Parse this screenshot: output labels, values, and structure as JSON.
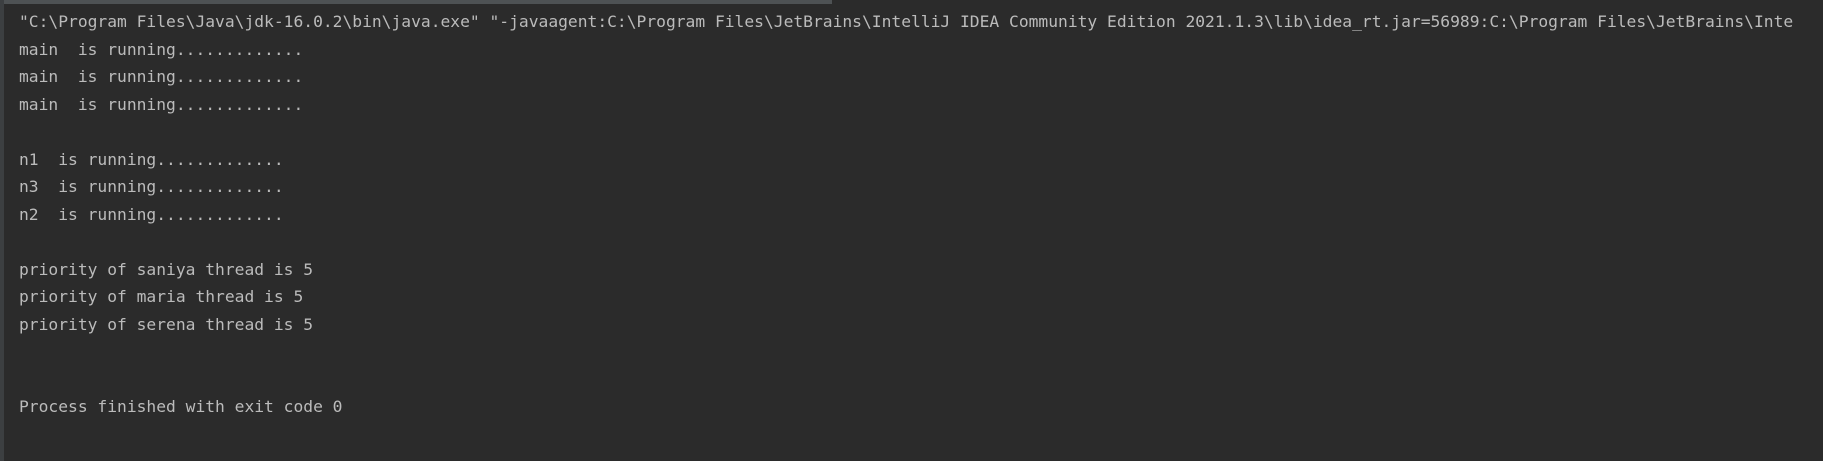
{
  "console": {
    "lines": [
      "\"C:\\Program Files\\Java\\jdk-16.0.2\\bin\\java.exe\" \"-javaagent:C:\\Program Files\\JetBrains\\IntelliJ IDEA Community Edition 2021.1.3\\lib\\idea_rt.jar=56989:C:\\Program Files\\JetBrains\\Inte",
      "main  is running.............",
      "main  is running.............",
      "main  is running.............",
      "",
      "n1  is running.............",
      "n3  is running.............",
      "n2  is running.............",
      "",
      "priority of saniya thread is 5",
      "priority of maria thread is 5",
      "priority of serena thread is 5",
      "",
      "",
      "Process finished with exit code 0"
    ]
  },
  "colors": {
    "background": "#2b2b2b",
    "text": "#bbbbbb",
    "gutter": "#3c3f41"
  }
}
